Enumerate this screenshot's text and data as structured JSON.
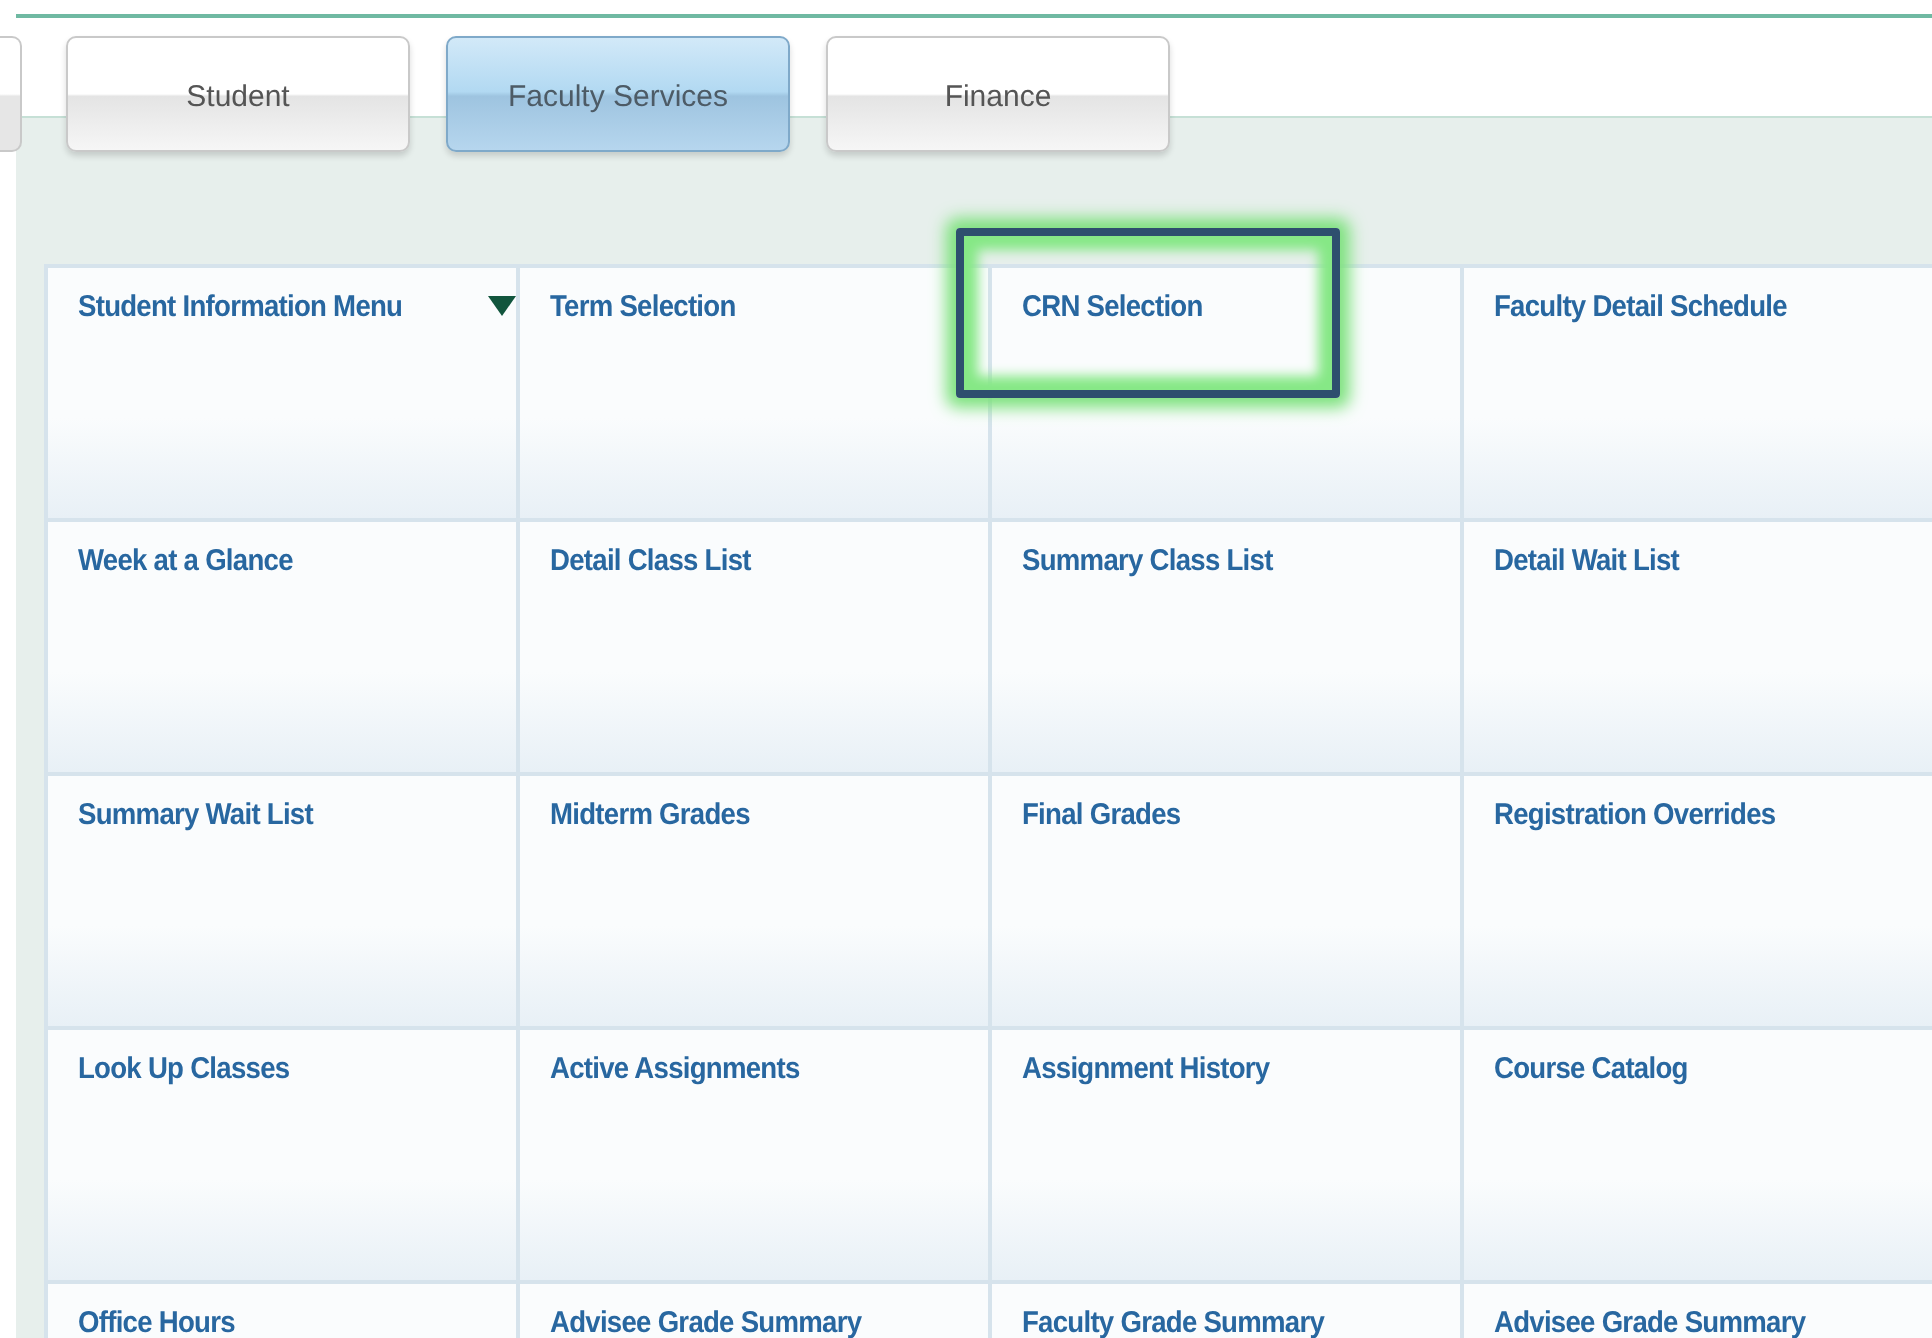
{
  "tabs": [
    {
      "kind": "partial",
      "selected": false
    },
    {
      "label": "Student",
      "kind": "tab",
      "selected": false
    },
    {
      "label": "Faculty Services",
      "kind": "tab",
      "selected": true
    },
    {
      "label": "Finance",
      "kind": "tab",
      "selected": false
    }
  ],
  "menu": {
    "items": [
      {
        "label": "Student Information Menu",
        "has_dropdown": true,
        "highlighted": false
      },
      {
        "label": "Term Selection",
        "has_dropdown": false,
        "highlighted": false
      },
      {
        "label": "CRN Selection",
        "has_dropdown": false,
        "highlighted": true
      },
      {
        "label": "Faculty Detail Schedule",
        "has_dropdown": false,
        "highlighted": false
      },
      {
        "label": "Week at a Glance",
        "has_dropdown": false,
        "highlighted": false
      },
      {
        "label": "Detail Class List",
        "has_dropdown": false,
        "highlighted": false
      },
      {
        "label": "Summary Class List",
        "has_dropdown": false,
        "highlighted": false
      },
      {
        "label": "Detail Wait List",
        "has_dropdown": false,
        "highlighted": false
      },
      {
        "label": "Summary Wait List",
        "has_dropdown": false,
        "highlighted": false
      },
      {
        "label": "Midterm Grades",
        "has_dropdown": false,
        "highlighted": false
      },
      {
        "label": "Final Grades",
        "has_dropdown": false,
        "highlighted": false
      },
      {
        "label": "Registration Overrides",
        "has_dropdown": false,
        "highlighted": false
      },
      {
        "label": "Look Up Classes",
        "has_dropdown": false,
        "highlighted": false
      },
      {
        "label": "Active Assignments",
        "has_dropdown": false,
        "highlighted": false
      },
      {
        "label": "Assignment History",
        "has_dropdown": false,
        "highlighted": false
      },
      {
        "label": "Course Catalog",
        "has_dropdown": false,
        "highlighted": false
      },
      {
        "label": "Office Hours",
        "has_dropdown": false,
        "highlighted": false
      },
      {
        "label": "Advisee Grade Summary",
        "has_dropdown": false,
        "highlighted": false
      },
      {
        "label": "Faculty Grade Summary",
        "has_dropdown": false,
        "highlighted": false
      },
      {
        "label": "Advisee Grade Summary",
        "has_dropdown": false,
        "highlighted": false
      }
    ]
  }
}
